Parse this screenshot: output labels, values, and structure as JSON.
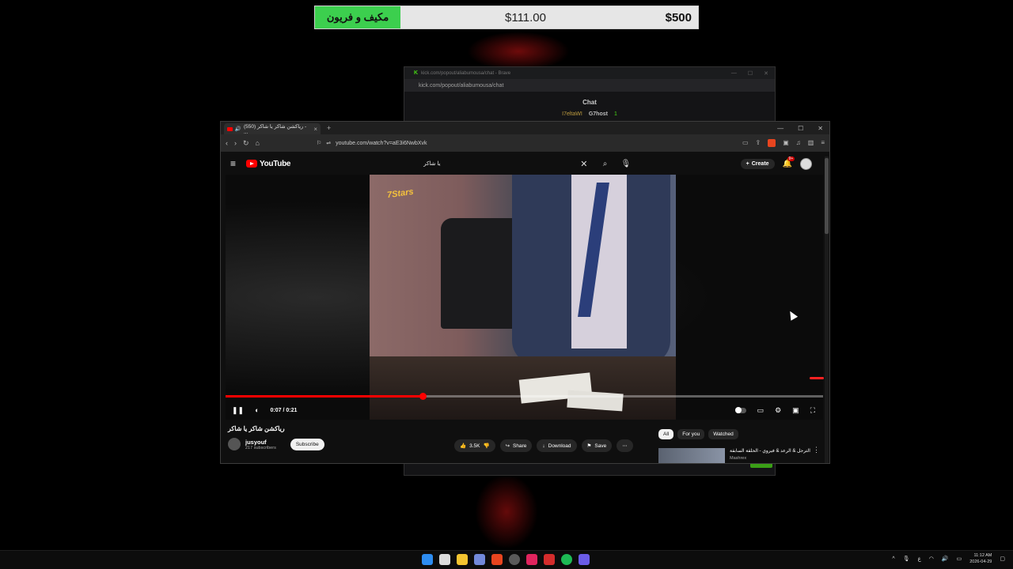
{
  "donation": {
    "label": "مكيف و فريون",
    "current": "$111.00",
    "goal": "$500"
  },
  "chat_window": {
    "title": "kick.com/popout/aliabumousa/chat - Brave",
    "url": "kick.com/popout/aliabumousa/chat",
    "header": "Chat",
    "message_user1": "I7eltaWI",
    "message_user2": "G7host",
    "message_badge": "1"
  },
  "browser": {
    "tab_title": "(550) رياكشن شاكر يا شاكر - ...",
    "url": "youtube.com/watch?v=aE3i6NwbXvk",
    "new_tab": "+"
  },
  "youtube": {
    "logo": "YouTube",
    "search_value": "يا شاكر",
    "create_label": "Create",
    "notif_badge": "9+",
    "video_overlay_logo": "7Stars",
    "time": "0:07 / 0:21",
    "progress": 0.33,
    "title": "رياكشن شاكر يا شاكر",
    "channel_name": "jusyouf",
    "channel_subs": "217 subscribers",
    "subscribe_label": "Subscribe",
    "likes": "3.5K",
    "share_label": "Share",
    "download_label": "Download",
    "save_label": "Save",
    "chips": [
      "All",
      "For you",
      "Watched"
    ],
    "reco_title": "الترجل & الرعد & فيروي - الحلقة السابقة",
    "reco_channel": "Mashrex"
  },
  "taskbar": {
    "clock_time": "11:12 AM",
    "clock_date": "2026-04-29",
    "lang": "ع"
  },
  "colors": {
    "kick_green": "#53fc18",
    "donation_green": "#3ccf4e",
    "yt_red": "#ff0000"
  }
}
